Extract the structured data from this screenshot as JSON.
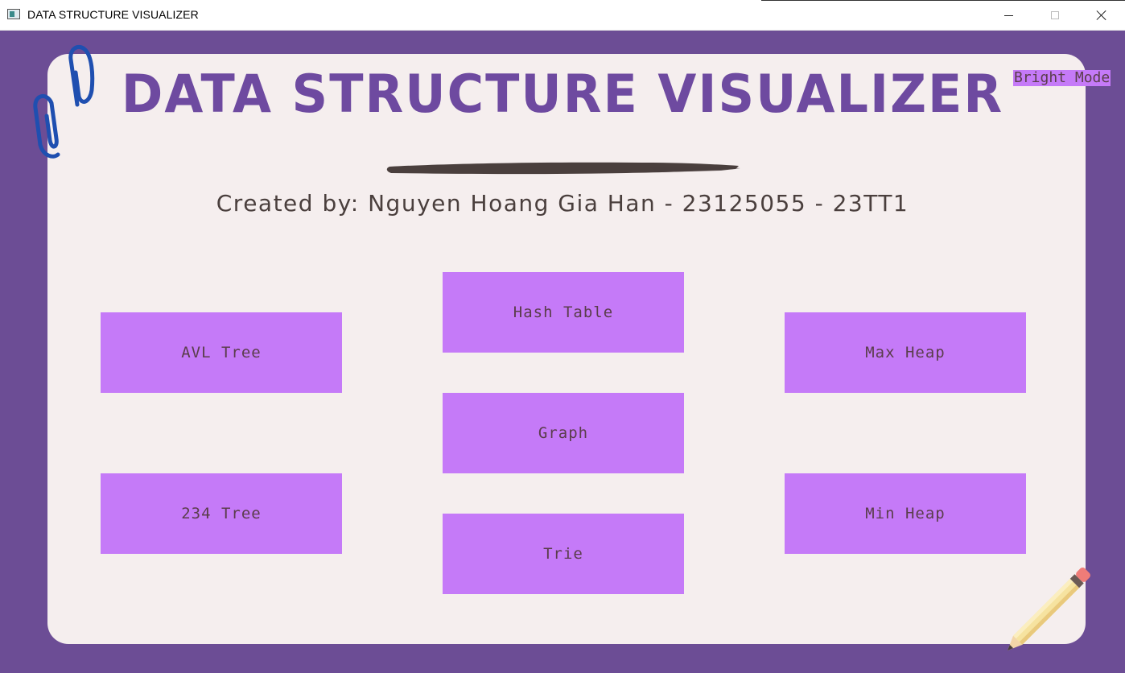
{
  "window": {
    "title": "DATA STRUCTURE VISUALIZER",
    "controls": [
      "minimize",
      "maximize",
      "close"
    ]
  },
  "header": {
    "title": "DATA STRUCTURE VISUALIZER",
    "subtitle": "Created by: Nguyen Hoang Gia Han - 23125055 - 23TT1"
  },
  "mode_toggle": {
    "label": "Bright Mode"
  },
  "menu": {
    "avl_tree": "AVL Tree",
    "tree_234": "234 Tree",
    "hash_table": "Hash Table",
    "graph": "Graph",
    "trie": "Trie",
    "max_heap": "Max Heap",
    "min_heap": "Min Heap"
  },
  "decorations": {
    "top_left": "paperclip-icon",
    "bottom_right": "pencil-icon"
  },
  "colors": {
    "background": "#6c4d95",
    "panel": "#f5eeee",
    "button": "#c57af8",
    "title": "#6e4aa0",
    "text": "#5a3d4b"
  }
}
